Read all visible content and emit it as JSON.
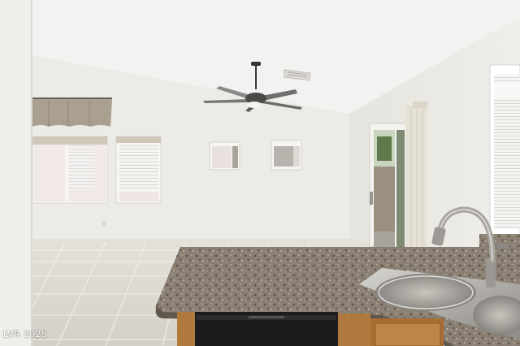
{
  "photo": {
    "watermark": "LVR 2025",
    "colors": {
      "wall": "#ecebe8",
      "ceiling": "#f3f2f0",
      "floor_tile": "#ddd9d1",
      "granite": "#8a8073",
      "sink_steel": "#b9b6b1",
      "cabinet_wood": "#b07a3e",
      "dishwasher": "#1c1c1c",
      "curtain": "#a9a090"
    }
  }
}
